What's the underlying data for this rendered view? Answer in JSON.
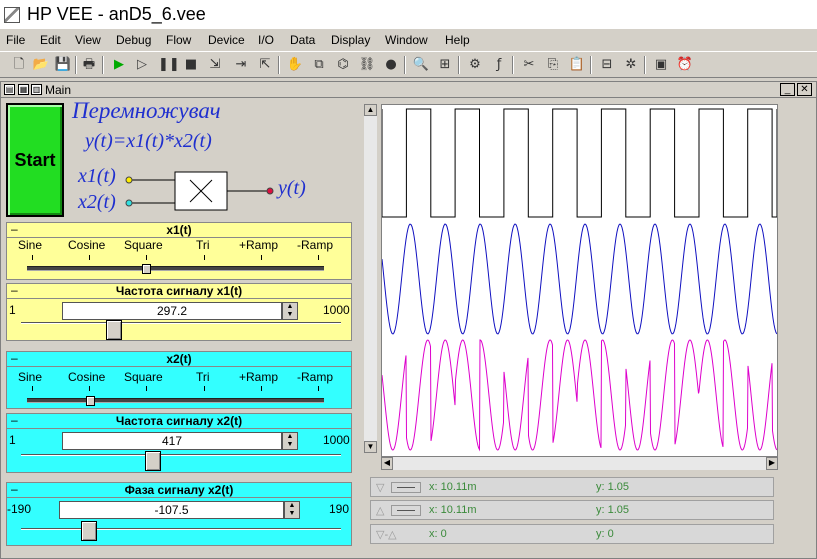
{
  "window": {
    "title": "HP VEE - anD5_6.vee"
  },
  "menu": [
    "File",
    "Edit",
    "View",
    "Debug",
    "Flow",
    "Device",
    "I/O",
    "Data",
    "Display",
    "Window",
    "Help"
  ],
  "main_window": {
    "title": "Main"
  },
  "start_button": {
    "label": "Start"
  },
  "diagram": {
    "title": "Перемножувач",
    "formula": "y(t)=x1(t)*x2(t)",
    "input1": "x1(t)",
    "input2": "x2(t)",
    "output": "y(t)"
  },
  "x1_panel": {
    "title": "x1(t)",
    "options": [
      "Sine",
      "Cosine",
      "Square",
      "Tri",
      "+Ramp",
      "-Ramp"
    ],
    "selected": "Square"
  },
  "x1_freq": {
    "title": "Частота сигналу  x1(t)",
    "min": "1",
    "max": "1000",
    "value": "297.2",
    "level": 0.297
  },
  "x2_panel": {
    "title": "x2(t)",
    "options": [
      "Sine",
      "Cosine",
      "Square",
      "Tri",
      "+Ramp",
      "-Ramp"
    ],
    "selected": "Cosine"
  },
  "x2_freq": {
    "title": "Частота сигналу  x2(t)",
    "min": "1",
    "max": "1000",
    "value": "417",
    "level": 0.417
  },
  "x2_phase": {
    "title": "Фаза сигналу  x2(t)",
    "min": "-190",
    "max": "190",
    "value": "-107.5",
    "level": 0.217
  },
  "markers": [
    {
      "symbol": "▽",
      "x": "x: 10.11m",
      "y": "y: 1.05"
    },
    {
      "symbol": "△",
      "x": "x: 10.11m",
      "y": "y: 1.05"
    },
    {
      "symbol": "▽-△",
      "x": "x: 0",
      "y": "y: 0"
    }
  ],
  "colors": {
    "x1_panel": "#ffff99",
    "x2_panel": "#33ffff",
    "start": "#22dd22",
    "trace_square": "#000000",
    "trace_cosine": "#1010c0",
    "trace_product": "#dd00cc"
  }
}
